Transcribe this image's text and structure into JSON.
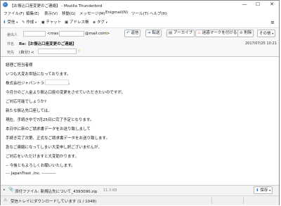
{
  "window": {
    "title": "【お振込口座変更のご連絡】 - Mozilla Thunderbird",
    "controls": {
      "minimize": "—",
      "maximize": "☐",
      "close": "✕"
    }
  },
  "menubar": {
    "items": [
      "ファイル(F)",
      "編集(E)",
      "表示(V)",
      "移動(G)",
      "メッセージ(M)",
      "Enigmail(N)",
      "ツール(T)",
      "ヘルプ(H)"
    ]
  },
  "toolbar": {
    "receive": "受信",
    "compose": "作成",
    "chat": "チャット",
    "address_book": "アドレス帳",
    "tag": "タグ"
  },
  "header": {
    "from_label": "差出人",
    "from_name": "<mas",
    "from_domain": "@mail.com>",
    "subject_label": "件名",
    "subject": "Re:【お振込口座変更のご連絡】",
    "to_label": "宛先",
    "to_value": "(自分) <",
    "date": "2017/07/25 10:21",
    "actions": {
      "reply": "返信",
      "forward": "転送",
      "archive": "アーカイブ",
      "junk": "迷惑マークを付ける",
      "delete": "削除",
      "other": "その他"
    }
  },
  "body": {
    "lines": [
      "経理ご担当者様",
      "いつも大変お世話になっております。",
      "株式会社ジャパントラストの                さです。",
      "今月分のご入金より振込口座の変更をさせていただきたいのですが、",
      "ご対応可能でしょうか?",
      "新たな振込先口座しては、",
      "現在、手続き中で7月25日に完了予定となります。",
      "本日中に新のご請求書データをお送り致しまして",
      "手続き完了次第、正式なご請求書データをお送り致します。",
      "急なご連絡になってしまい大変申し訳ございませんが、",
      "ご対応をいただけますと大変助かります。",
      "-- 今後ともよろしくお願いいたします。",
      "--- JapanTrast ,Inc. ----------"
    ]
  },
  "attachment": {
    "label": "添付ファイル: 新規込先について_4393090.zip",
    "size": "11.3 KB",
    "save": "保存"
  },
  "statusbar": {
    "text": "受信トレイにダウンロードしています (1 / 1048)"
  }
}
